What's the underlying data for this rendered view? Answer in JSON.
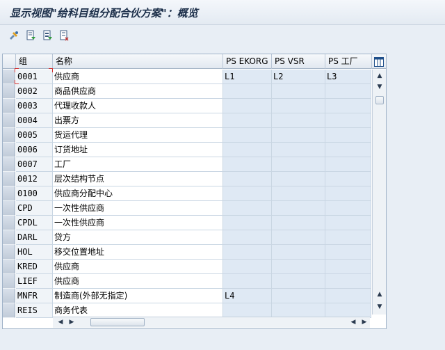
{
  "window": {
    "title": "显示视图\"给科目组分配合伙方案\"：概览"
  },
  "toolbar": {
    "icons": [
      "display-change-icon",
      "details-icon",
      "select-all-icon",
      "deselect-all-icon"
    ]
  },
  "table": {
    "columns": {
      "group": "组",
      "name": "名称",
      "ps_ekorg": "PS EKORG",
      "ps_vsr": "PS VSR",
      "ps_plant": "PS 工厂"
    },
    "rows": [
      {
        "group": "0001",
        "name": "供应商",
        "ps_ekorg": "L1",
        "ps_vsr": "L2",
        "ps_plant": "L3"
      },
      {
        "group": "0002",
        "name": "商品供应商",
        "ps_ekorg": "",
        "ps_vsr": "",
        "ps_plant": ""
      },
      {
        "group": "0003",
        "name": "代理收款人",
        "ps_ekorg": "",
        "ps_vsr": "",
        "ps_plant": ""
      },
      {
        "group": "0004",
        "name": "出票方",
        "ps_ekorg": "",
        "ps_vsr": "",
        "ps_plant": ""
      },
      {
        "group": "0005",
        "name": "货运代理",
        "ps_ekorg": "",
        "ps_vsr": "",
        "ps_plant": ""
      },
      {
        "group": "0006",
        "name": "订货地址",
        "ps_ekorg": "",
        "ps_vsr": "",
        "ps_plant": ""
      },
      {
        "group": "0007",
        "name": "工厂",
        "ps_ekorg": "",
        "ps_vsr": "",
        "ps_plant": ""
      },
      {
        "group": "0012",
        "name": "层次结构节点",
        "ps_ekorg": "",
        "ps_vsr": "",
        "ps_plant": ""
      },
      {
        "group": "0100",
        "name": "供应商分配中心",
        "ps_ekorg": "",
        "ps_vsr": "",
        "ps_plant": ""
      },
      {
        "group": "CPD",
        "name": "一次性供应商",
        "ps_ekorg": "",
        "ps_vsr": "",
        "ps_plant": ""
      },
      {
        "group": "CPDL",
        "name": "一次性供应商",
        "ps_ekorg": "",
        "ps_vsr": "",
        "ps_plant": ""
      },
      {
        "group": "DARL",
        "name": "贷方",
        "ps_ekorg": "",
        "ps_vsr": "",
        "ps_plant": ""
      },
      {
        "group": "HOL",
        "name": "移交位置地址",
        "ps_ekorg": "",
        "ps_vsr": "",
        "ps_plant": ""
      },
      {
        "group": "KRED",
        "name": "供应商",
        "ps_ekorg": "",
        "ps_vsr": "",
        "ps_plant": ""
      },
      {
        "group": "LIEF",
        "name": "供应商",
        "ps_ekorg": "",
        "ps_vsr": "",
        "ps_plant": ""
      },
      {
        "group": "MNFR",
        "name": "制造商(外部无指定)",
        "ps_ekorg": "L4",
        "ps_vsr": "",
        "ps_plant": ""
      },
      {
        "group": "REIS",
        "name": "商务代表",
        "ps_ekorg": "",
        "ps_vsr": "",
        "ps_plant": ""
      }
    ]
  },
  "scrollbars": {
    "vertical": {
      "up_icon": "scroll-up-icon",
      "down_icon": "scroll-down-icon"
    },
    "horizontal": {
      "left_icon": "scroll-left-icon",
      "right_icon": "scroll-right-icon"
    }
  },
  "column_config_icon": "column-settings-icon"
}
